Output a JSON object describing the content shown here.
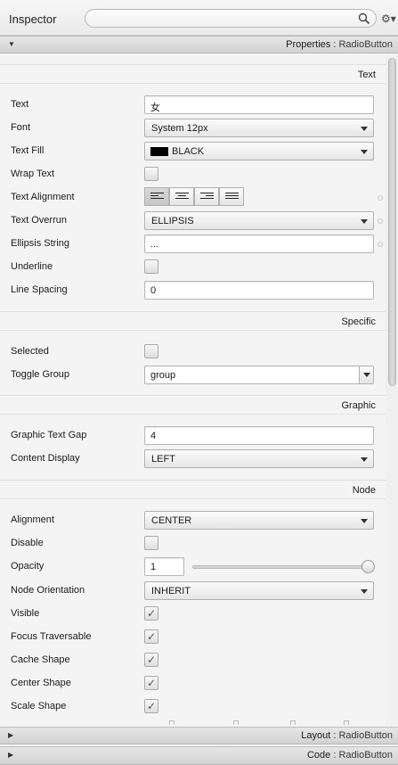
{
  "inspector": {
    "title": "Inspector",
    "search_placeholder": ""
  },
  "sections": {
    "properties": {
      "title": "Properties",
      "sep": " : ",
      "subject": "RadioButton",
      "expanded": true
    },
    "layout": {
      "title": "Layout",
      "sep": " : ",
      "subject": "RadioButton",
      "expanded": false
    },
    "code": {
      "title": "Code",
      "sep": " : ",
      "subject": "RadioButton",
      "expanded": false
    }
  },
  "groups": {
    "text": "Text",
    "specific": "Specific",
    "graphic": "Graphic",
    "node": "Node"
  },
  "fields": {
    "text": {
      "label": "Text",
      "value": "女"
    },
    "font": {
      "label": "Font",
      "value": "System 12px"
    },
    "text_fill": {
      "label": "Text Fill",
      "value": "BLACK",
      "color": "#000000"
    },
    "wrap_text": {
      "label": "Wrap Text",
      "checked": false
    },
    "text_alignment": {
      "label": "Text Alignment",
      "options": [
        "left",
        "center",
        "right",
        "justify"
      ],
      "selected": "left"
    },
    "text_overrun": {
      "label": "Text Overrun",
      "value": "ELLIPSIS"
    },
    "ellipsis_string": {
      "label": "Ellipsis String",
      "value": "..."
    },
    "underline": {
      "label": "Underline",
      "checked": false
    },
    "line_spacing": {
      "label": "Line Spacing",
      "value": "0"
    },
    "selected": {
      "label": "Selected",
      "checked": false
    },
    "toggle_group": {
      "label": "Toggle Group",
      "value": "group"
    },
    "graphic_text_gap": {
      "label": "Graphic Text Gap",
      "value": "4"
    },
    "content_display": {
      "label": "Content Display",
      "value": "LEFT"
    },
    "alignment": {
      "label": "Alignment",
      "value": "CENTER"
    },
    "disable": {
      "label": "Disable",
      "checked": false
    },
    "opacity": {
      "label": "Opacity",
      "value": "1",
      "slider_fraction": 1.0
    },
    "node_orientation": {
      "label": "Node Orientation",
      "value": "INHERIT"
    },
    "visible": {
      "label": "Visible",
      "checked": true
    },
    "focus_traversable": {
      "label": "Focus Traversable",
      "checked": true
    },
    "cache_shape": {
      "label": "Cache Shape",
      "checked": true
    },
    "center_shape": {
      "label": "Center Shape",
      "checked": true
    },
    "scale_shape": {
      "label": "Scale Shape",
      "checked": true
    }
  },
  "icons": {
    "search": "magnifier-icon",
    "settings": "gear-icon",
    "expanded_arrow": "▼",
    "collapsed_arrow": "▶"
  }
}
